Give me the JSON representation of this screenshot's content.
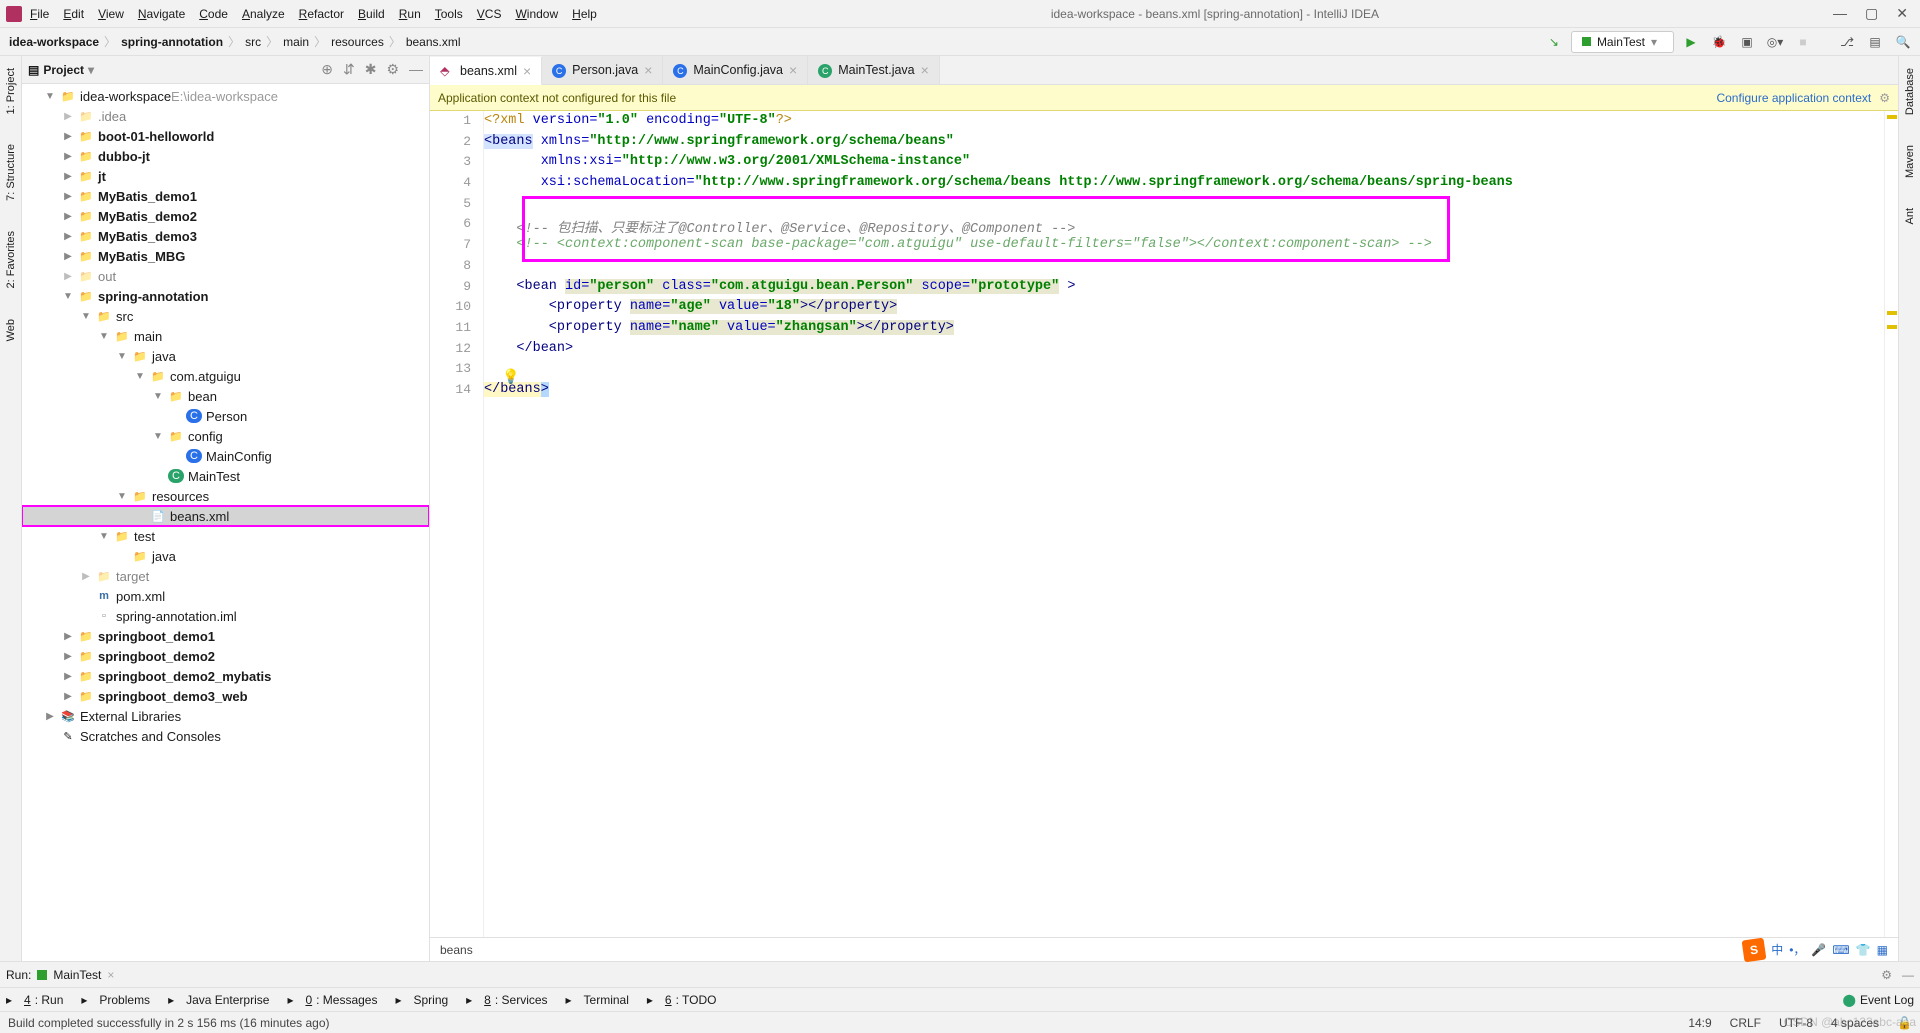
{
  "title": "idea-workspace - beans.xml [spring-annotation] - IntelliJ IDEA",
  "menus": [
    "File",
    "Edit",
    "View",
    "Navigate",
    "Code",
    "Analyze",
    "Refactor",
    "Build",
    "Run",
    "Tools",
    "VCS",
    "Window",
    "Help"
  ],
  "breadcrumbs": [
    "idea-workspace",
    "spring-annotation",
    "src",
    "main",
    "resources",
    "beans.xml"
  ],
  "run_config": "MainTest",
  "project_panel": {
    "title": "Project"
  },
  "left_rail": [
    "1: Project",
    "7: Structure",
    "2: Favorites",
    "Web"
  ],
  "right_rail": [
    "Database",
    "Maven",
    "Ant"
  ],
  "tree": [
    {
      "d": 0,
      "a": "▼",
      "ic": "folder-blue",
      "label": "idea-workspace",
      "suffix": "  E:\\idea-workspace"
    },
    {
      "d": 1,
      "a": "▶",
      "ic": "folder-grey",
      "label": ".idea",
      "ignored": true
    },
    {
      "d": 1,
      "a": "▶",
      "ic": "folder-closed",
      "label": "boot-01-helloworld",
      "bold": true
    },
    {
      "d": 1,
      "a": "▶",
      "ic": "folder-closed",
      "label": "dubbo-jt",
      "bold": true
    },
    {
      "d": 1,
      "a": "▶",
      "ic": "folder-closed",
      "label": "jt",
      "bold": true
    },
    {
      "d": 1,
      "a": "▶",
      "ic": "folder-closed",
      "label": "MyBatis_demo1",
      "bold": true
    },
    {
      "d": 1,
      "a": "▶",
      "ic": "folder-closed",
      "label": "MyBatis_demo2",
      "bold": true
    },
    {
      "d": 1,
      "a": "▶",
      "ic": "folder-closed",
      "label": "MyBatis_demo3",
      "bold": true
    },
    {
      "d": 1,
      "a": "▶",
      "ic": "folder-closed",
      "label": "MyBatis_MBG",
      "bold": true
    },
    {
      "d": 1,
      "a": "▶",
      "ic": "folder-orange",
      "label": "out",
      "ignored": true
    },
    {
      "d": 1,
      "a": "▼",
      "ic": "folder-closed",
      "label": "spring-annotation",
      "bold": true
    },
    {
      "d": 2,
      "a": "▼",
      "ic": "folder-blue",
      "label": "src"
    },
    {
      "d": 3,
      "a": "▼",
      "ic": "folder-blue",
      "label": "main"
    },
    {
      "d": 4,
      "a": "▼",
      "ic": "folder-blue",
      "label": "java"
    },
    {
      "d": 5,
      "a": "▼",
      "ic": "folder-closed",
      "label": "com.atguigu"
    },
    {
      "d": 6,
      "a": "▼",
      "ic": "folder-closed",
      "label": "bean"
    },
    {
      "d": 7,
      "a": "",
      "ic": "icon-class",
      "label": "Person"
    },
    {
      "d": 6,
      "a": "▼",
      "ic": "folder-closed",
      "label": "config"
    },
    {
      "d": 7,
      "a": "",
      "ic": "icon-class",
      "label": "MainConfig"
    },
    {
      "d": 6,
      "a": "",
      "ic": "icon-class-g",
      "label": "MainTest"
    },
    {
      "d": 4,
      "a": "▼",
      "ic": "folder-res",
      "label": "resources"
    },
    {
      "d": 5,
      "a": "",
      "ic": "icon-xml",
      "label": "beans.xml",
      "selected": true,
      "highlighted": true
    },
    {
      "d": 3,
      "a": "▼",
      "ic": "folder-blue",
      "label": "test"
    },
    {
      "d": 4,
      "a": "",
      "ic": "folder-closed",
      "label": "java"
    },
    {
      "d": 2,
      "a": "▶",
      "ic": "folder-orange",
      "label": "target",
      "ignored": true
    },
    {
      "d": 2,
      "a": "",
      "ic": "icon-m",
      "label": "pom.xml"
    },
    {
      "d": 2,
      "a": "",
      "ic": "icon-iml",
      "label": "spring-annotation.iml"
    },
    {
      "d": 1,
      "a": "▶",
      "ic": "folder-closed",
      "label": "springboot_demo1",
      "bold": true
    },
    {
      "d": 1,
      "a": "▶",
      "ic": "folder-closed",
      "label": "springboot_demo2",
      "bold": true
    },
    {
      "d": 1,
      "a": "▶",
      "ic": "folder-closed",
      "label": "springboot_demo2_mybatis",
      "bold": true
    },
    {
      "d": 1,
      "a": "▶",
      "ic": "folder-closed",
      "label": "springboot_demo3_web",
      "bold": true
    },
    {
      "d": 0,
      "a": "▶",
      "ic": "lib",
      "label": "External Libraries"
    },
    {
      "d": 0,
      "a": "",
      "ic": "scratch",
      "label": "Scratches and Consoles"
    }
  ],
  "tabs": [
    {
      "label": "beans.xml",
      "icon": "xml",
      "active": true
    },
    {
      "label": "Person.java",
      "icon": "class"
    },
    {
      "label": "MainConfig.java",
      "icon": "class"
    },
    {
      "label": "MainTest.java",
      "icon": "class-g"
    }
  ],
  "warning": {
    "text": "Application context not configured for this file",
    "link": "Configure application context"
  },
  "gutter_lines": 14,
  "code": {
    "l1": "<?xml version=\"1.0\" encoding=\"UTF-8\"?>",
    "l2a": "<beans",
    "l2b": " xmlns=",
    "l2c": "\"http://www.springframework.org/schema/beans\"",
    "l3a": "       xmlns:xsi=",
    "l3b": "\"http://www.w3.org/2001/XMLSchema-instance\"",
    "l4a": "       xsi:schemaLocation=",
    "l4b": "\"http://www.springframework.org/schema/beans http://www.springframework.org/schema/beans/spring-beans",
    "l6": "    <!-- 包扫描、只要标注了@Controller、@Service、@Repository、@Component -->",
    "l7": "    <!-- <context:component-scan base-package=\"com.atguigu\" use-default-filters=\"false\"></context:component-scan> -->",
    "l9a": "    <bean ",
    "l9id": "id=",
    "l9idv": "\"person\"",
    "l9cl": " class=",
    "l9clv": "\"com.atguigu.bean.Person\"",
    "l9sc": " scope=",
    "l9scv": "\"prototype\"",
    "l9e": " >",
    "l10a": "        <property ",
    "l10n": "name=",
    "l10nv": "\"age\"",
    "l10v": " value=",
    "l10vv": "\"18\"",
    "l10e": "></property>",
    "l11a": "        <property ",
    "l11n": "name=",
    "l11nv": "\"name\"",
    "l11v": " value=",
    "l11vv": "\"zhangsan\"",
    "l11e": "></property>",
    "l12": "    </bean>",
    "l14": "</beans>"
  },
  "editor_crumb": "beans",
  "run_tool": {
    "label": "Run:",
    "name": "MainTest"
  },
  "tool_windows": [
    "4: Run",
    "Problems",
    "Java Enterprise",
    "0: Messages",
    "Spring",
    "8: Services",
    "Terminal",
    "6: TODO"
  ],
  "event_log": "Event Log",
  "status": {
    "msg": "Build completed successfully in 2 s 156 ms (16 minutes ago)",
    "pos": "14:9",
    "eol": "CRLF",
    "enc": "UTF-8",
    "spaces": "4 spaces"
  },
  "watermark": "CSDN @abc123abc-aaa"
}
